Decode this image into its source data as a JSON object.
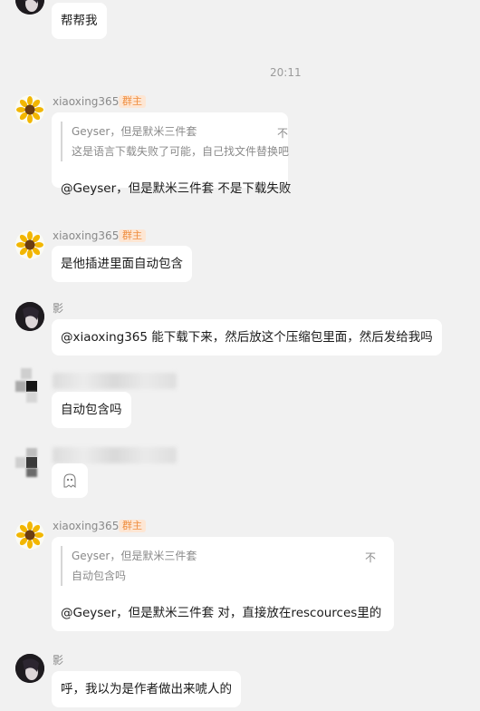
{
  "messages": {
    "m0": {
      "text": "帮帮我"
    },
    "time": "20:11",
    "m1": {
      "sender": "xiaoxing365",
      "badge": "群主",
      "quote_line1": "Geyser，但是默米三件套",
      "quote_line2": "这是语言下载失败了可能，自己找文件替换吧",
      "quote_close": "不",
      "text": "@Geyser，但是默米三件套 不是下载失败"
    },
    "m2": {
      "sender": "xiaoxing365",
      "badge": "群主",
      "text": "是他插进里面自动包含"
    },
    "m3": {
      "sender": "影",
      "text": "@xiaoxing365 能下载下来，然后放这个压缩包里面，然后发给我吗"
    },
    "m4": {
      "text": "自动包含吗"
    },
    "m5": {
      "sticker": "ghost-sticker"
    },
    "m6": {
      "sender": "xiaoxing365",
      "badge": "群主",
      "quote_line1": "Geyser，但是默米三件套",
      "quote_line2": "自动包含吗",
      "quote_close": "不",
      "text": "@Geyser，但是默米三件套 对，直接放在rescources里的"
    },
    "m7": {
      "sender": "影",
      "text": "呼，我以为是作者做出来唬人的"
    }
  }
}
